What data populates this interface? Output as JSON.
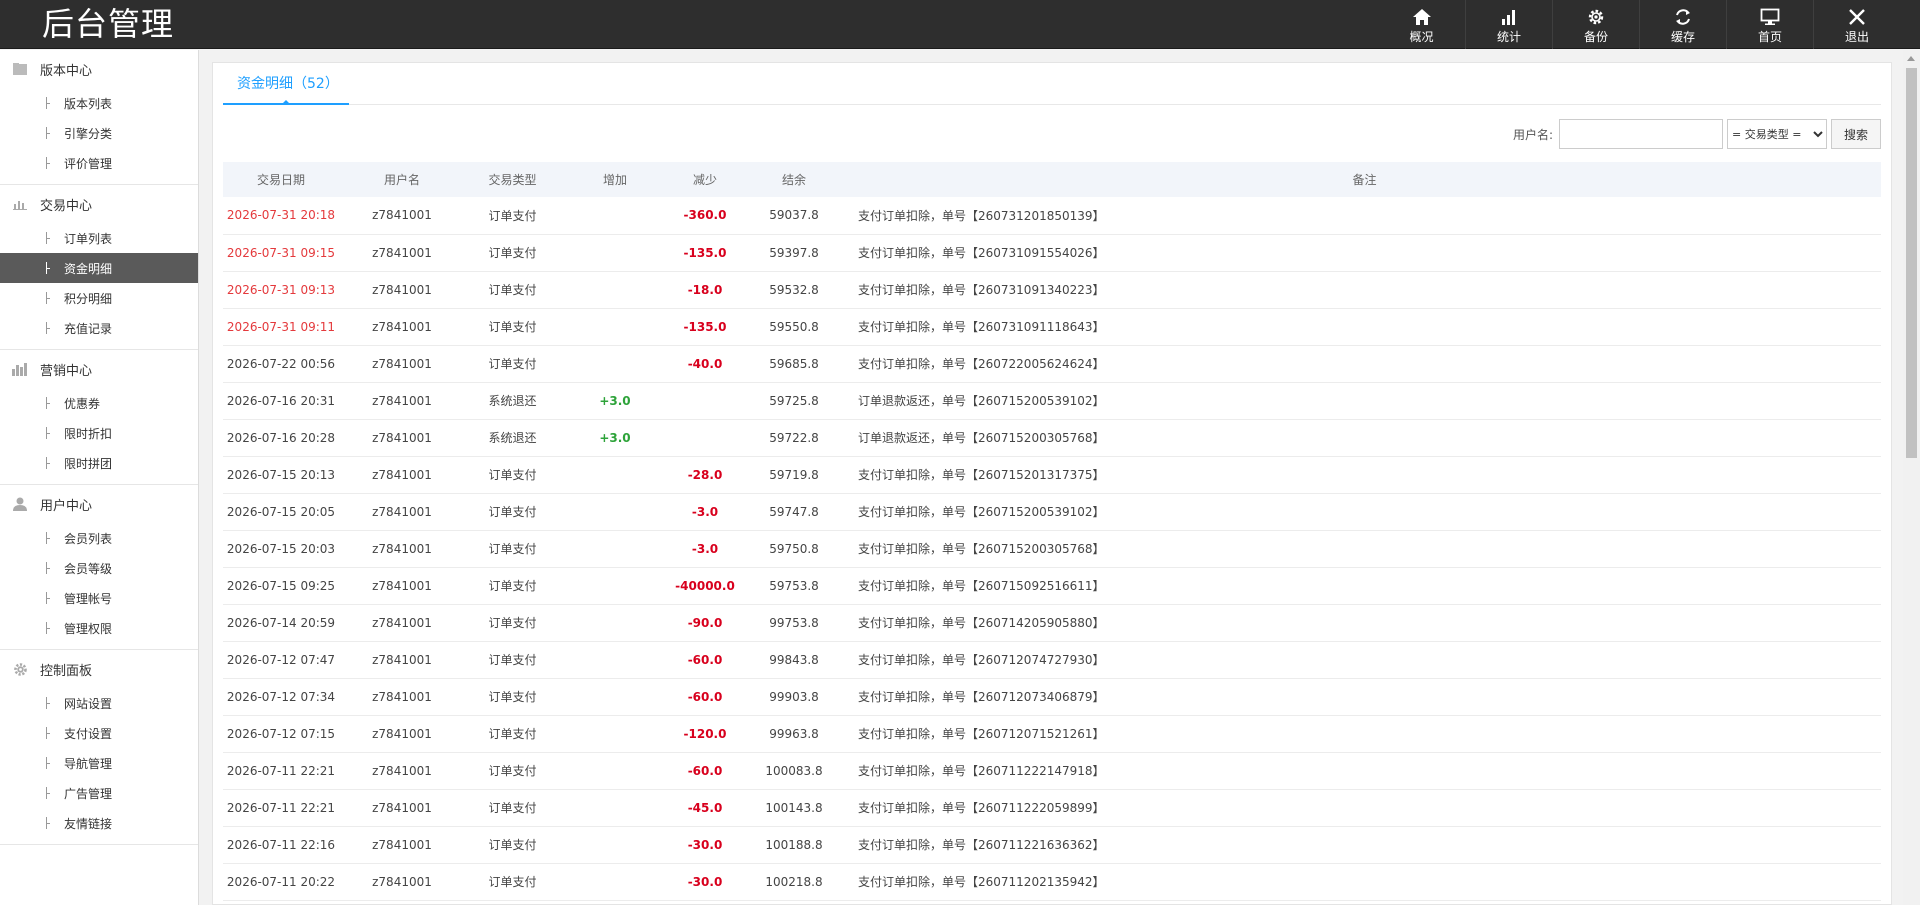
{
  "app": {
    "title": "后台管理"
  },
  "topnav": [
    {
      "label": "概况",
      "icon": "home-icon"
    },
    {
      "label": "统计",
      "icon": "bar-chart-icon"
    },
    {
      "label": "备份",
      "icon": "gear-icon"
    },
    {
      "label": "缓存",
      "icon": "refresh-icon"
    },
    {
      "label": "首页",
      "icon": "monitor-icon"
    },
    {
      "label": "退出",
      "icon": "close-icon"
    }
  ],
  "sidebar": {
    "groups": [
      {
        "title": "版本中心",
        "icon": "folder-icon",
        "items": [
          "版本列表",
          "引擎分类",
          "评价管理"
        ]
      },
      {
        "title": "交易中心",
        "icon": "bar-chart-icon",
        "items": [
          "订单列表",
          "资金明细",
          "积分明细",
          "充值记录"
        ]
      },
      {
        "title": "营销中心",
        "icon": "column-chart-icon",
        "items": [
          "优惠券",
          "限时折扣",
          "限时拼团"
        ]
      },
      {
        "title": "用户中心",
        "icon": "user-icon",
        "items": [
          "会员列表",
          "会员等级",
          "管理帐号",
          "管理权限"
        ]
      },
      {
        "title": "控制面板",
        "icon": "gear-icon",
        "items": [
          "网站设置",
          "支付设置",
          "导航管理",
          "广告管理",
          "友情链接"
        ]
      }
    ],
    "active_item": "资金明细"
  },
  "tab": {
    "label": "资金明细（52）"
  },
  "search": {
    "label": "用户名:",
    "input_value": "",
    "select_value": "= 交易类型 =",
    "button_label": "搜索"
  },
  "table": {
    "headers": [
      "交易日期",
      "用户名",
      "交易类型",
      "增加",
      "减少",
      "结余",
      "备注"
    ],
    "rows": [
      {
        "date": "2026-07-31 20:18",
        "user": "z7841001",
        "type": "订单支付",
        "inc": "",
        "dec": "-360.0",
        "balance": "59037.8",
        "note": "支付订单扣除，单号【260731201850139】",
        "highlight": true
      },
      {
        "date": "2026-07-31 09:15",
        "user": "z7841001",
        "type": "订单支付",
        "inc": "",
        "dec": "-135.0",
        "balance": "59397.8",
        "note": "支付订单扣除，单号【260731091554026】",
        "highlight": true
      },
      {
        "date": "2026-07-31 09:13",
        "user": "z7841001",
        "type": "订单支付",
        "inc": "",
        "dec": "-18.0",
        "balance": "59532.8",
        "note": "支付订单扣除，单号【260731091340223】",
        "highlight": true
      },
      {
        "date": "2026-07-31 09:11",
        "user": "z7841001",
        "type": "订单支付",
        "inc": "",
        "dec": "-135.0",
        "balance": "59550.8",
        "note": "支付订单扣除，单号【260731091118643】",
        "highlight": true
      },
      {
        "date": "2026-07-22 00:56",
        "user": "z7841001",
        "type": "订单支付",
        "inc": "",
        "dec": "-40.0",
        "balance": "59685.8",
        "note": "支付订单扣除，单号【260722005624624】",
        "highlight": false
      },
      {
        "date": "2026-07-16 20:31",
        "user": "z7841001",
        "type": "系统退还",
        "inc": "+3.0",
        "dec": "",
        "balance": "59725.8",
        "note": "订单退款返还，单号【260715200539102】",
        "highlight": false
      },
      {
        "date": "2026-07-16 20:28",
        "user": "z7841001",
        "type": "系统退还",
        "inc": "+3.0",
        "dec": "",
        "balance": "59722.8",
        "note": "订单退款返还，单号【260715200305768】",
        "highlight": false
      },
      {
        "date": "2026-07-15 20:13",
        "user": "z7841001",
        "type": "订单支付",
        "inc": "",
        "dec": "-28.0",
        "balance": "59719.8",
        "note": "支付订单扣除，单号【260715201317375】",
        "highlight": false
      },
      {
        "date": "2026-07-15 20:05",
        "user": "z7841001",
        "type": "订单支付",
        "inc": "",
        "dec": "-3.0",
        "balance": "59747.8",
        "note": "支付订单扣除，单号【260715200539102】",
        "highlight": false
      },
      {
        "date": "2026-07-15 20:03",
        "user": "z7841001",
        "type": "订单支付",
        "inc": "",
        "dec": "-3.0",
        "balance": "59750.8",
        "note": "支付订单扣除，单号【260715200305768】",
        "highlight": false
      },
      {
        "date": "2026-07-15 09:25",
        "user": "z7841001",
        "type": "订单支付",
        "inc": "",
        "dec": "-40000.0",
        "balance": "59753.8",
        "note": "支付订单扣除，单号【260715092516611】",
        "highlight": false
      },
      {
        "date": "2026-07-14 20:59",
        "user": "z7841001",
        "type": "订单支付",
        "inc": "",
        "dec": "-90.0",
        "balance": "99753.8",
        "note": "支付订单扣除，单号【260714205905880】",
        "highlight": false
      },
      {
        "date": "2026-07-12 07:47",
        "user": "z7841001",
        "type": "订单支付",
        "inc": "",
        "dec": "-60.0",
        "balance": "99843.8",
        "note": "支付订单扣除，单号【260712074727930】",
        "highlight": false
      },
      {
        "date": "2026-07-12 07:34",
        "user": "z7841001",
        "type": "订单支付",
        "inc": "",
        "dec": "-60.0",
        "balance": "99903.8",
        "note": "支付订单扣除，单号【260712073406879】",
        "highlight": false
      },
      {
        "date": "2026-07-12 07:15",
        "user": "z7841001",
        "type": "订单支付",
        "inc": "",
        "dec": "-120.0",
        "balance": "99963.8",
        "note": "支付订单扣除，单号【260712071521261】",
        "highlight": false
      },
      {
        "date": "2026-07-11 22:21",
        "user": "z7841001",
        "type": "订单支付",
        "inc": "",
        "dec": "-60.0",
        "balance": "100083.8",
        "note": "支付订单扣除，单号【260711222147918】",
        "highlight": false
      },
      {
        "date": "2026-07-11 22:21",
        "user": "z7841001",
        "type": "订单支付",
        "inc": "",
        "dec": "-45.0",
        "balance": "100143.8",
        "note": "支付订单扣除，单号【260711222059899】",
        "highlight": false
      },
      {
        "date": "2026-07-11 22:16",
        "user": "z7841001",
        "type": "订单支付",
        "inc": "",
        "dec": "-30.0",
        "balance": "100188.8",
        "note": "支付订单扣除，单号【260711221636362】",
        "highlight": false
      },
      {
        "date": "2026-07-11 20:22",
        "user": "z7841001",
        "type": "订单支付",
        "inc": "",
        "dec": "-30.0",
        "balance": "100218.8",
        "note": "支付订单扣除，单号【260711202135942】",
        "highlight": false
      }
    ]
  },
  "colors": {
    "accent": "#1e9fff",
    "increase": "#2ea33a",
    "decrease": "#d8001d",
    "highlight_date": "#e4393c",
    "topbar": "#2e2e2e"
  }
}
